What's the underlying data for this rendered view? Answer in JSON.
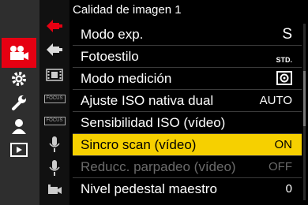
{
  "header": {
    "title": "Calidad de imagen 1"
  },
  "items": [
    {
      "label": "Modo exp.",
      "value": "S"
    },
    {
      "label": "Fotoestilo",
      "value": "STD."
    },
    {
      "label": "Modo medición",
      "value": ""
    },
    {
      "label": "Ajuste ISO nativa dual",
      "value": "AUTO"
    },
    {
      "label": "Sensibilidad ISO (vídeo)",
      "value": ""
    },
    {
      "label": "Sincro scan (vídeo)",
      "value": "ON"
    },
    {
      "label": "Reducc. parpadeo (vídeo)",
      "value": "OFF"
    },
    {
      "label": "Nivel pedestal maestro",
      "value": "0"
    }
  ],
  "sub_tabs": {
    "focus_1": "FOCUS",
    "focus_2": "FOCUS"
  },
  "colors": {
    "accent": "#e60012",
    "highlight": "#f6d000",
    "disabled": "#6a6a6a"
  }
}
